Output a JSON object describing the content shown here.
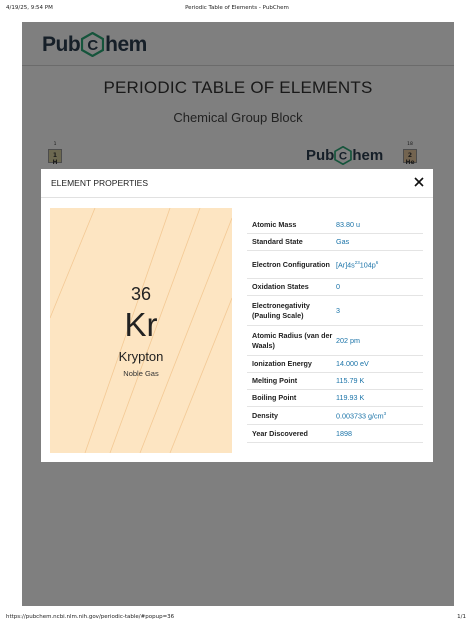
{
  "print_header": {
    "date": "4/19/25, 9:54 PM",
    "title": "Periodic Table of Elements - PubChem"
  },
  "print_footer": {
    "url": "https://pubchem.ncbi.nlm.nih.gov/periodic-table/#popup=36",
    "page": "1/1"
  },
  "site": {
    "logo_left": "Pub",
    "logo_letter": "C",
    "logo_right": "hem"
  },
  "page": {
    "title": "PERIODIC TABLE OF ELEMENTS",
    "subtitle": "Chemical Group Block"
  },
  "background_elements": [
    {
      "group": "1",
      "number": "1",
      "symbol": "H",
      "color": "#d9d1a0"
    },
    {
      "group": "18",
      "number": "2",
      "symbol": "He",
      "color": "#e6c8a0"
    }
  ],
  "modal": {
    "title": "ELEMENT PROPERTIES",
    "close_label": "×",
    "element": {
      "atomic_number": "36",
      "symbol": "Kr",
      "name": "Krypton",
      "group": "Noble Gas",
      "card_color": "#fde5c2"
    },
    "properties": [
      {
        "label": "Atomic Mass",
        "value": "83.80 u"
      },
      {
        "label": "Standard State",
        "value": "Gas"
      },
      {
        "label": "Electron Configuration",
        "value": "[Ar]4s23d104p6"
      },
      {
        "label": "Oxidation States",
        "value": "0"
      },
      {
        "label": "Electronegativity (Pauling Scale)",
        "value": "3"
      },
      {
        "label": "Atomic Radius (van der Waals)",
        "value": "202 pm"
      },
      {
        "label": "Ionization Energy",
        "value": "14.000 eV"
      },
      {
        "label": "Melting Point",
        "value": "115.79 K"
      },
      {
        "label": "Boiling Point",
        "value": "119.93 K"
      },
      {
        "label": "Density",
        "value": "0.003733 g/cm3"
      },
      {
        "label": "Year Discovered",
        "value": "1898"
      }
    ]
  },
  "colors": {
    "accent_link": "#1a73a8",
    "logo_text": "#2c3e50",
    "logo_hex": "#2aa876",
    "overlay": "rgba(0,0,0,0.5)"
  }
}
